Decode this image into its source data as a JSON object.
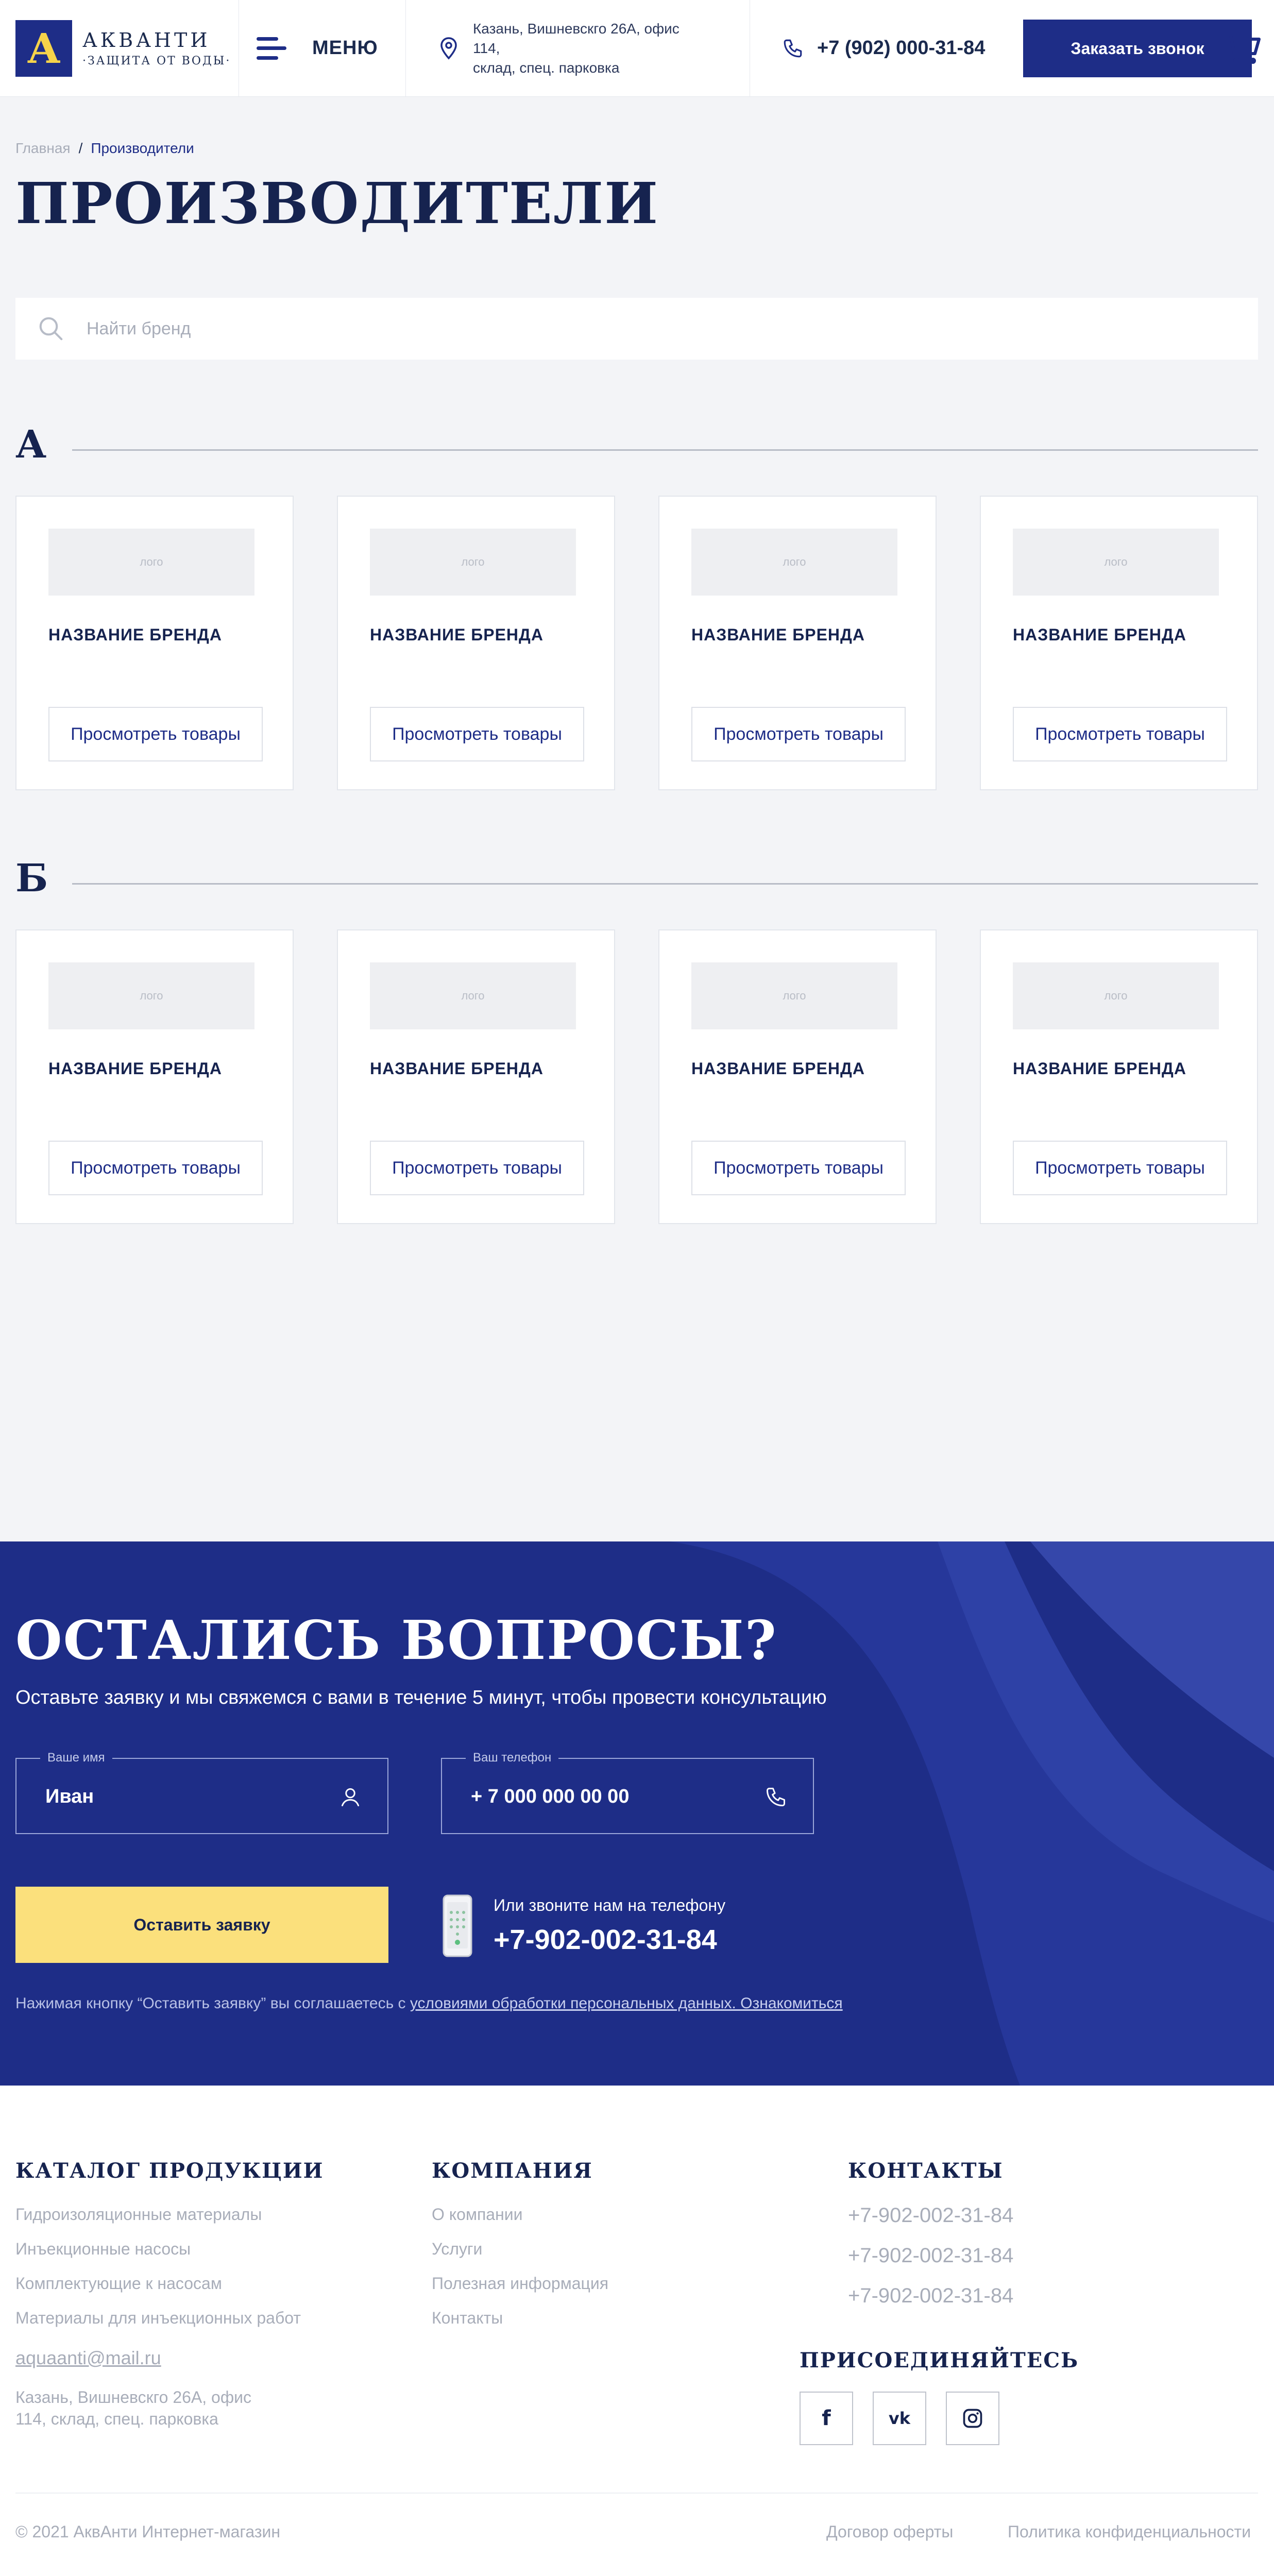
{
  "header": {
    "logo_title": "АКВАНТИ",
    "logo_sub": "·ЗАЩИТА ОТ ВОДЫ·",
    "logo_letter": "A",
    "menu_label": "МЕНЮ",
    "address": "Казань, Вишневскго 26А, офис 114,\nсклад, спец. парковка",
    "phone": "+7 (902) 000-31-84",
    "cta": "Заказать звонок"
  },
  "breadcrumb": {
    "home": "Главная",
    "separator": "/",
    "current": "Производители"
  },
  "page_title": "ПРОИЗВОДИТЕЛИ",
  "search": {
    "placeholder": "Найти бренд"
  },
  "sections": [
    {
      "letter": "А",
      "cards": [
        {
          "logo": "лого",
          "name": "НАЗВАНИЕ БРЕНДА",
          "button": "Просмотреть товары"
        },
        {
          "logo": "лого",
          "name": "НАЗВАНИЕ БРЕНДА",
          "button": "Просмотреть товары"
        },
        {
          "logo": "лого",
          "name": "НАЗВАНИЕ БРЕНДА",
          "button": "Просмотреть товары"
        },
        {
          "logo": "лого",
          "name": "НАЗВАНИЕ БРЕНДА",
          "button": "Просмотреть товары"
        }
      ]
    },
    {
      "letter": "Б",
      "cards": [
        {
          "logo": "лого",
          "name": "НАЗВАНИЕ БРЕНДА",
          "button": "Просмотреть товары"
        },
        {
          "logo": "лого",
          "name": "НАЗВАНИЕ БРЕНДА",
          "button": "Просмотреть товары"
        },
        {
          "logo": "лого",
          "name": "НАЗВАНИЕ БРЕНДА",
          "button": "Просмотреть товары"
        },
        {
          "logo": "лого",
          "name": "НАЗВАНИЕ БРЕНДА",
          "button": "Просмотреть товары"
        }
      ]
    }
  ],
  "questions": {
    "title": "ОСТАЛИСЬ ВОПРОСЫ?",
    "subtitle": "Оставьте заявку и мы свяжемся с вами в течение 5 минут, чтобы провести консультацию",
    "name_label": "Ваше имя",
    "name_value": "Иван",
    "phone_label": "Ваш телефон",
    "phone_value": "+ 7 000 000 00 00",
    "submit": "Оставить заявку",
    "call_hint": "Или звоните нам на телефону",
    "call_number": "+7-902-002-31-84",
    "agree_text": "Нажимая кнопку “Оставить заявку” вы соглашаетесь с ",
    "agree_link": "условиями обработки персональных данных. Ознакомиться"
  },
  "footer": {
    "catalog_title": "КАТАЛОГ ПРОДУКЦИИ",
    "catalog_links": [
      "Гидроизоляционные материалы",
      "Инъекционные насосы",
      "Комплектующие к насосам",
      "Материалы для инъекционных работ"
    ],
    "email": "aquaanti@mail.ru",
    "address": "Казань, Вишневскго 26А, офис\n114, склад, спец. парковка",
    "company_title": "КОМПАНИЯ",
    "company_links": [
      "О компании",
      "Услуги",
      "Полезная информация",
      "Контакты"
    ],
    "contacts_title": "КОНТАКТЫ",
    "phones": [
      "+7-902-002-31-84",
      "+7-902-002-31-84",
      "+7-902-002-31-84"
    ],
    "join_title": "ПРИСОЕДИНЯЙТЕСЬ",
    "socials": [
      "facebook-icon",
      "vk-icon",
      "instagram-icon"
    ],
    "social_labels": {
      "facebook": "f",
      "vk": "vk"
    },
    "copyright": "© 2021 АквАнти Интернет-магазин",
    "offer": "Договор оферты",
    "privacy": "Политика конфиденциальности"
  },
  "colors": {
    "brand_blue": "#1E2D87",
    "accent_yellow": "#FBE07C",
    "text_dark": "#16234F",
    "muted": "#A8ADB9",
    "bg": "#F3F4F7"
  }
}
